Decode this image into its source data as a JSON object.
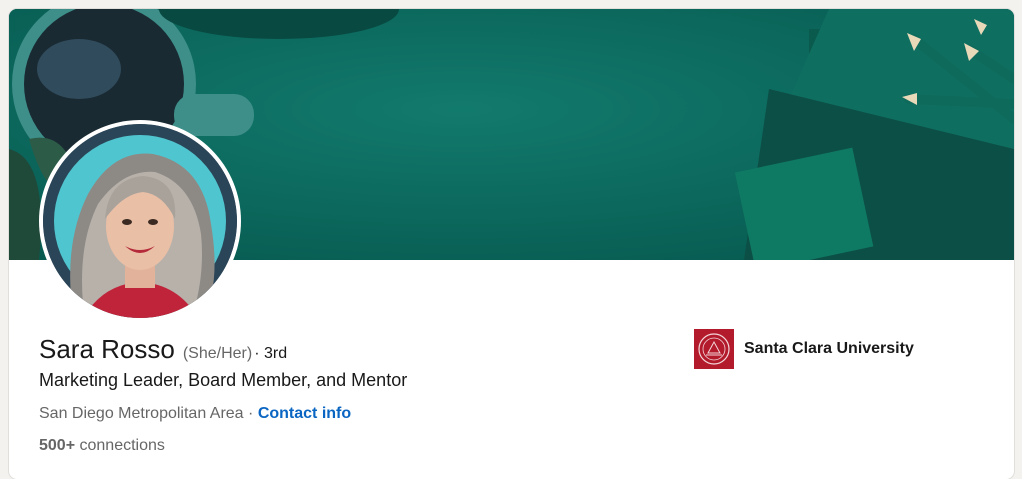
{
  "profile": {
    "name": "Sara Rosso",
    "pronouns": "(She/Her)",
    "degree": "· 3rd",
    "headline": "Marketing Leader, Board Member, and Mentor",
    "location": "San Diego Metropolitan Area",
    "separator": "·",
    "contact_label": "Contact info",
    "connections_count": "500+",
    "connections_label": "connections"
  },
  "education": {
    "school": "Santa Clara University",
    "logo_icon": "university-seal-icon"
  },
  "colors": {
    "banner": "#0b6b5f",
    "link": "#0a66c2",
    "school_logo": "#b31b2c"
  }
}
